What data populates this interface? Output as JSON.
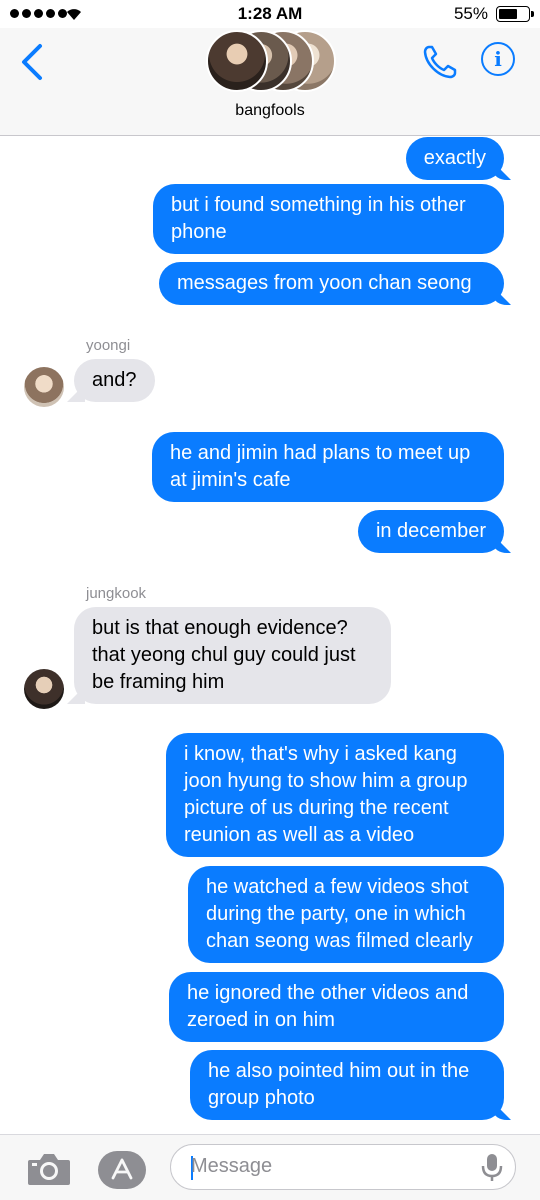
{
  "status_bar": {
    "time": "1:28 AM",
    "battery_percent": "55%",
    "battery_level": 0.55,
    "signal_icon": "signal-dots",
    "wifi_icon": "wifi-icon"
  },
  "header": {
    "group_name": "bangfools",
    "back_icon": "chevron-left-icon",
    "call_icon": "phone-icon",
    "info_icon": "info-icon",
    "info_glyph": "i"
  },
  "messages": [
    {
      "direction": "out",
      "text": "exactly"
    },
    {
      "direction": "out",
      "text": "but i found something in his other phone"
    },
    {
      "direction": "out",
      "text": "messages from yoon chan seong"
    },
    {
      "direction": "in",
      "sender": "yoongi",
      "text": "and?"
    },
    {
      "direction": "out",
      "text": "he and jimin had plans to meet up at jimin's cafe"
    },
    {
      "direction": "out",
      "text": "in december"
    },
    {
      "direction": "in",
      "sender": "jungkook",
      "text": "but is that enough evidence? that yeong chul guy could just be framing him"
    },
    {
      "direction": "out",
      "text": "i know, that's why i asked kang joon hyung to show him a group picture of us during the recent reunion as well as a video"
    },
    {
      "direction": "out",
      "text": "he watched a few videos shot during the party, one in which chan seong was filmed clearly"
    },
    {
      "direction": "out",
      "text": "he ignored the other videos and zeroed in on him"
    },
    {
      "direction": "out",
      "text": "he also pointed him out in the group photo"
    }
  ],
  "input_bar": {
    "placeholder": "Message",
    "value": "",
    "camera_icon": "camera-icon",
    "apps_icon": "app-store-icon",
    "mic_icon": "microphone-icon"
  },
  "colors": {
    "outgoing_bubble": "#0a7cff",
    "incoming_bubble": "#e5e5ea",
    "accent": "#0a7cff"
  }
}
